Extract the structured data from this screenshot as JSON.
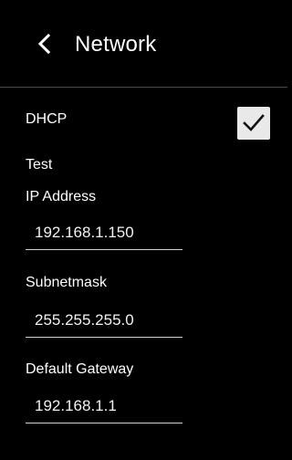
{
  "header": {
    "back_icon": "chevron-left-icon",
    "title": "Network"
  },
  "dhcp": {
    "label": "DHCP",
    "checked": true,
    "check_icon": "checkmark-icon"
  },
  "test": {
    "label": "Test"
  },
  "fields": {
    "ip_address": {
      "label": "IP Address",
      "value": "192.168.1.150"
    },
    "subnet_mask": {
      "label": "Subnetmask",
      "value": "255.255.255.0"
    },
    "default_gateway": {
      "label": "Default Gateway",
      "value": "192.168.1.1"
    }
  },
  "colors": {
    "background": "#000000",
    "text": "#ffffff",
    "checkbox_bg": "#e9e9e9",
    "divider": "#4a4a4a"
  }
}
